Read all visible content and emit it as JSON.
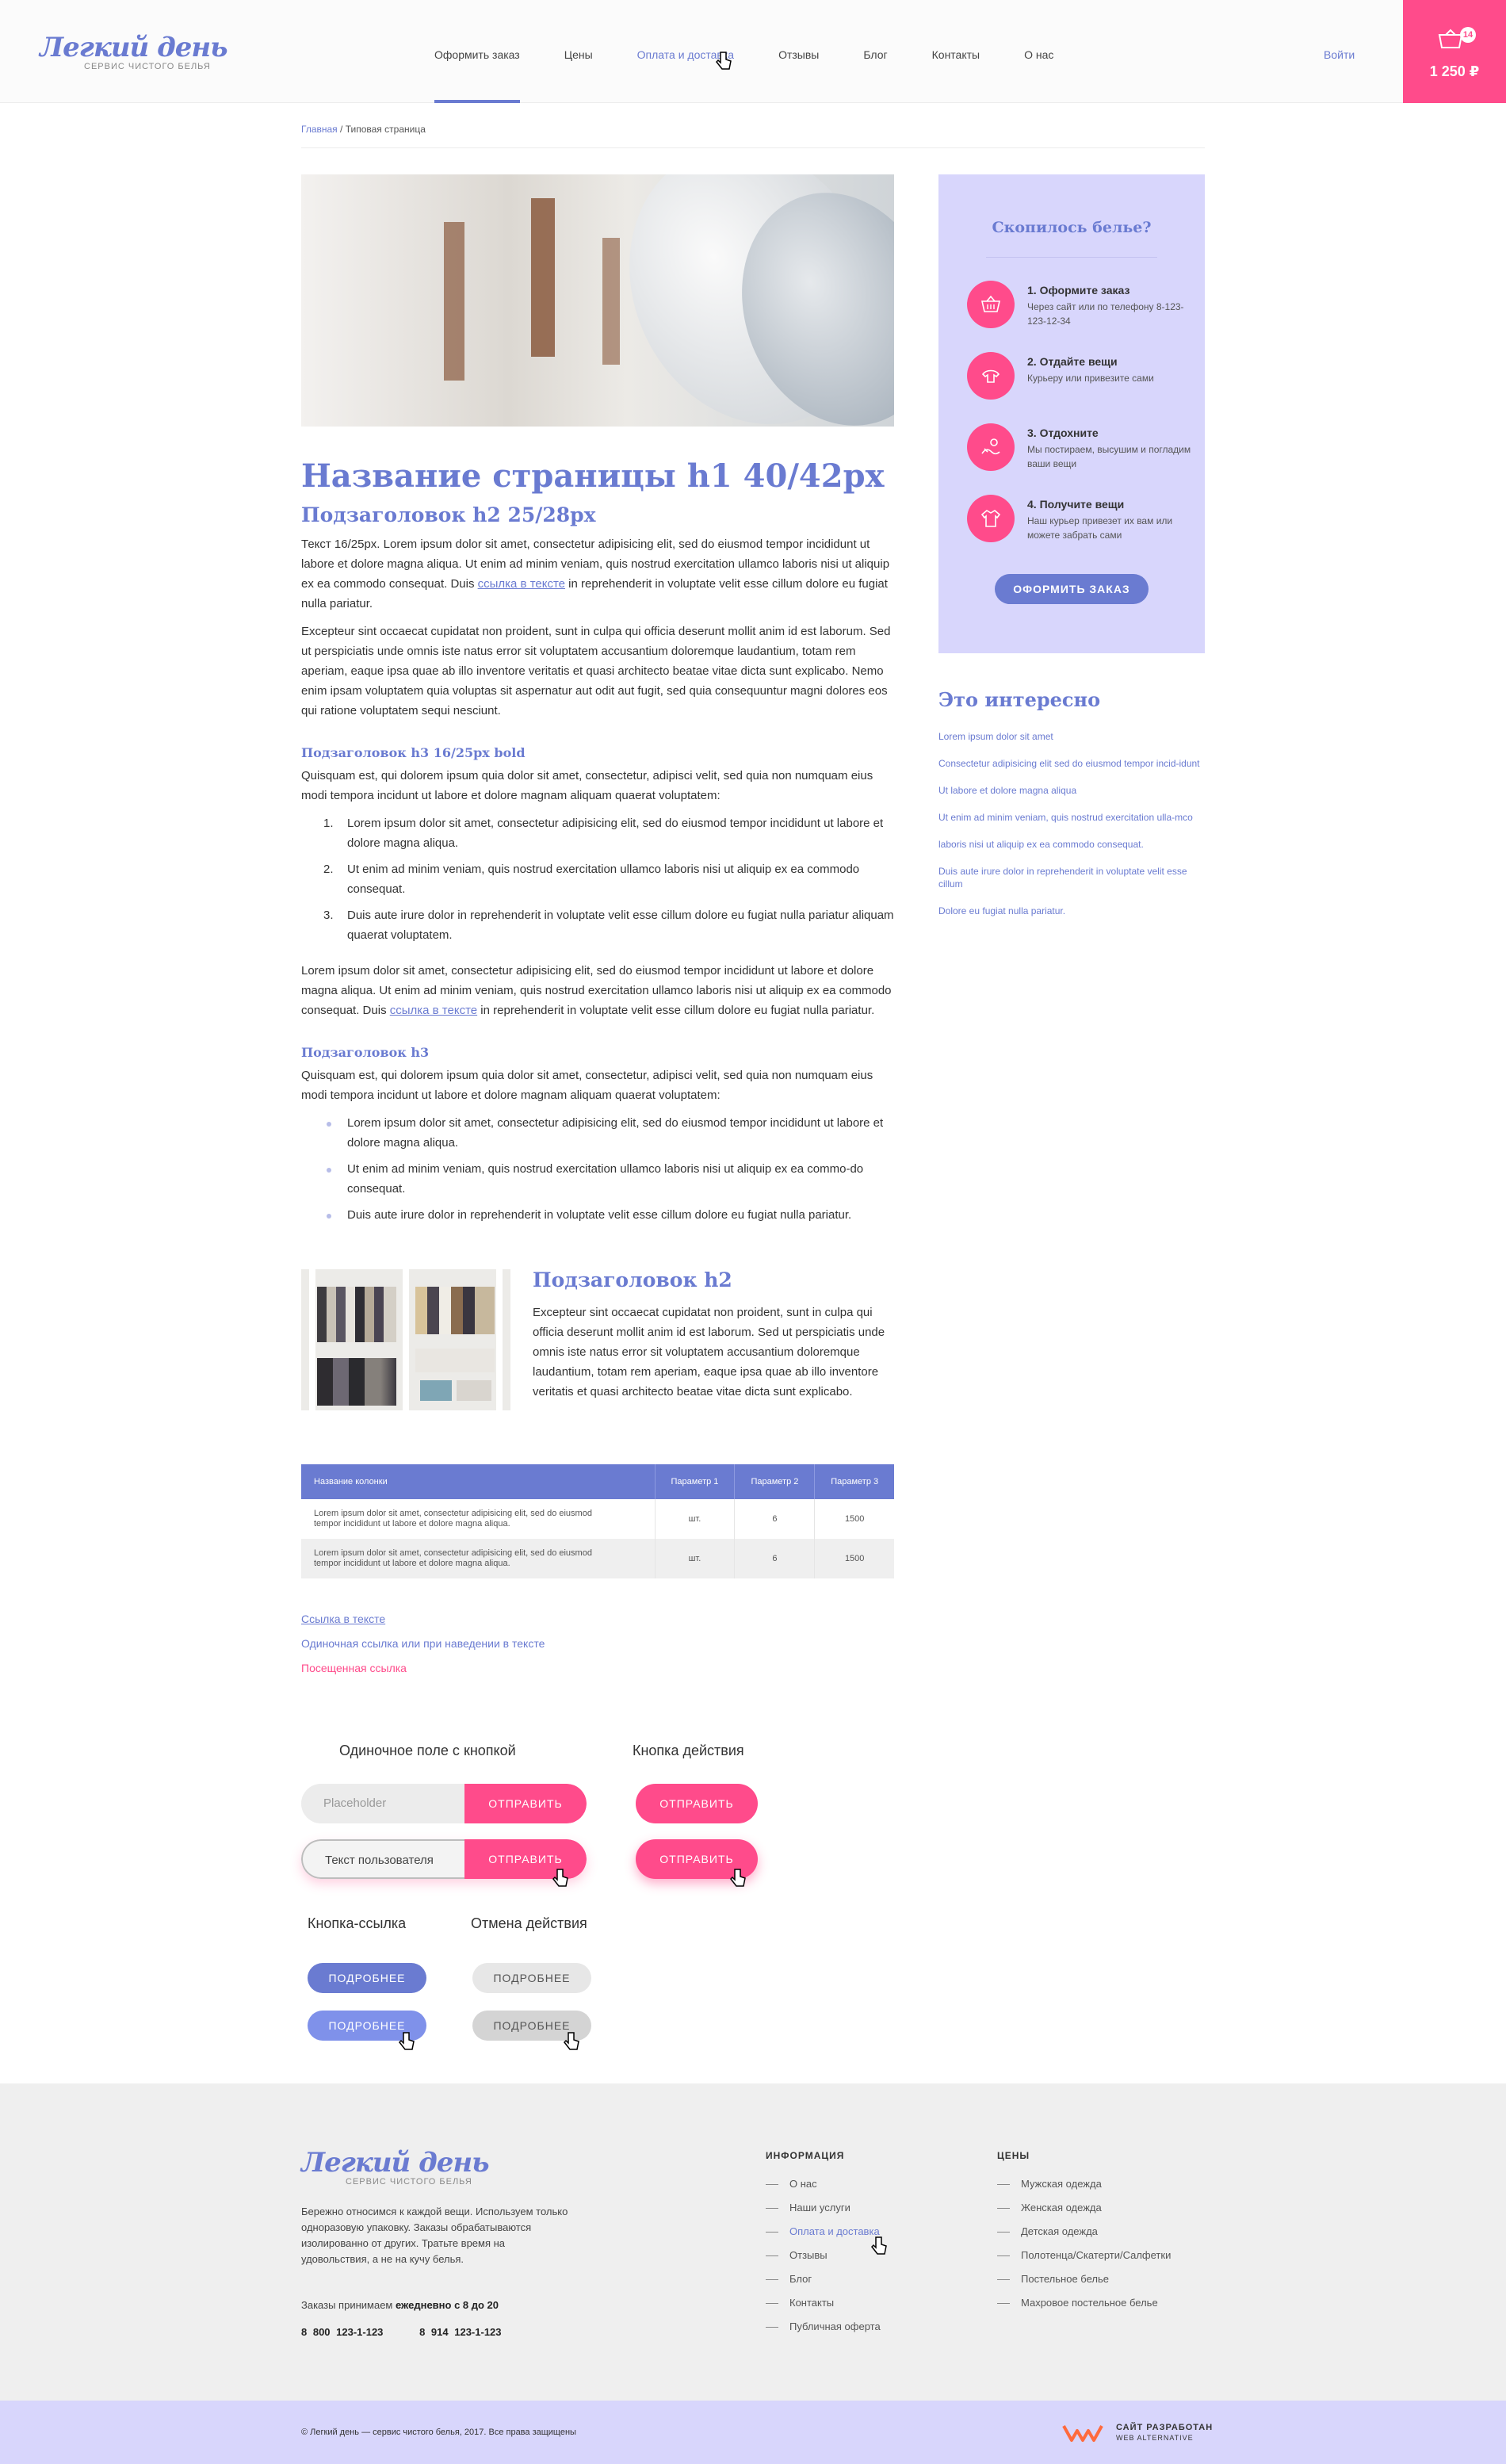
{
  "header": {
    "logo_main": "Легкий день",
    "logo_sub": "СЕРВИС ЧИСТОГО БЕЛЬЯ",
    "nav": [
      "Оформить заказ",
      "Цены",
      "Оплата и доставка",
      "Отзывы",
      "Блог",
      "Контакты",
      "О нас"
    ],
    "login": "Войти",
    "cart_count": "14",
    "cart_sum": "1 250 ₽"
  },
  "breadcrumb": {
    "home": "Главная",
    "sep": "/",
    "current": "Типовая страница"
  },
  "content": {
    "h1": "Название страницы h1 40/42px",
    "h2": "Подзаголовок h2 25/28px",
    "p1_before": "Текст 16/25px. Lorem ipsum dolor sit amet, consectetur adipisicing elit, sed do eiusmod tempor incididunt ut labore et dolore magna aliqua. Ut enim ad minim veniam, quis nostrud exercitation ullamco laboris nisi ut aliquip ex ea commodo consequat. Duis ",
    "p1_link": "ссылка в тексте",
    "p1_after": " in reprehenderit in voluptate velit esse cillum dolore eu fugiat nulla pariatur.",
    "p2": "Excepteur sint occaecat cupidatat non proident, sunt in culpa qui officia deserunt mollit anim id est laborum. Sed ut perspiciatis unde omnis iste natus error sit voluptatem accusantium doloremque laudantium, totam rem aperiam, eaque ipsa quae ab illo inventore veritatis et quasi architecto beatae vitae dicta sunt explicabo. Nemo enim ipsam voluptatem quia voluptas sit aspernatur aut odit aut fugit, sed quia consequuntur magni dolores eos qui ratione voluptatem sequi nesciunt.",
    "h3a": "Подзаголовок h3 16/25px bold",
    "p3": "Quisquam est, qui dolorem ipsum quia dolor sit amet, consectetur, adipisci velit, sed quia non numquam eius modi tempora incidunt ut labore et dolore magnam aliquam quaerat voluptatem:",
    "ol": [
      {
        "n": "1.",
        "t": "Lorem ipsum dolor sit amet, consectetur adipisicing elit, sed do eiusmod tempor incididunt ut labore et dolore magna aliqua."
      },
      {
        "n": "2.",
        "t": "Ut enim ad minim veniam, quis nostrud exercitation ullamco laboris nisi ut aliquip ex ea commodo consequat."
      },
      {
        "n": "3.",
        "t": "Duis aute irure dolor in reprehenderit in voluptate velit esse cillum dolore eu fugiat nulla pariatur aliquam quaerat voluptatem."
      }
    ],
    "p4_before": "Lorem ipsum dolor sit amet, consectetur adipisicing elit, sed do eiusmod tempor incididunt ut labore et dolore magna aliqua. Ut enim ad minim veniam, quis nostrud exercitation ullamco laboris nisi ut aliquip ex ea commodo consequat. Duis ",
    "p4_link": "ссылка в тексте",
    "p4_after": " in reprehenderit in voluptate velit esse cillum dolore eu fugiat nulla pariatur.",
    "h3b": "Подзаголовок h3",
    "p5": "Quisquam est, qui dolorem ipsum quia dolor sit amet, consectetur, adipisci velit, sed quia non numquam eius modi tempora incidunt ut labore et dolore magnam aliquam quaerat voluptatem:",
    "ul": [
      "Lorem ipsum dolor sit amet, consectetur adipisicing elit, sed do eiusmod tempor incididunt ut labore et dolore magna aliqua.",
      "Ut enim ad minim veniam, quis nostrud exercitation ullamco laboris nisi ut aliquip ex ea commo-do consequat.",
      "Duis aute irure dolor in reprehenderit in voluptate velit esse cillum dolore eu fugiat nulla pariatur."
    ],
    "media_h2": "Подзаголовок h2",
    "media_p": "Excepteur sint occaecat cupidatat non proident, sunt in culpa qui officia deserunt mollit anim id est laborum. Sed ut perspiciatis unde omnis iste natus error sit voluptatem accusantium doloremque laudantium, totam rem aperiam, eaque ipsa quae ab illo inventore veritatis et quasi architecto beatae vitae dicta sunt explicabo."
  },
  "table": {
    "headers": [
      "Название колонки",
      "Параметр 1",
      "Параметр 2",
      "Параметр 3"
    ],
    "rows": [
      [
        "Lorem ipsum dolor sit amet, consectetur adipisicing elit, sed do eiusmod tempor incididunt ut labore et dolore magna aliqua.",
        "шт.",
        "6",
        "1500"
      ],
      [
        "Lorem ipsum dolor sit amet, consectetur adipisicing elit, sed do eiusmod tempor incididunt ut labore et dolore magna aliqua.",
        "шт.",
        "6",
        "1500"
      ]
    ]
  },
  "links": {
    "l1": "Ссылка в тексте",
    "l2": "Одиночная ссылка или при наведении в тексте",
    "l3": "Посещенная ссылка"
  },
  "forms": {
    "field_title": "Одиночное поле с кнопкой",
    "action_title": "Кнопка действия",
    "placeholder": "Placeholder",
    "user_text": "Текст пользователя",
    "send": "ОТПРАВИТЬ",
    "link_btn_title": "Кнопка-ссылка",
    "cancel_title": "Отмена действия",
    "more": "ПОДРОБНЕЕ"
  },
  "sidebar": {
    "howto_title": "Скопилось белье?",
    "steps": [
      {
        "title": "1. Оформите заказ",
        "desc": "Через сайт или по телефону 8-123-123-12-34",
        "icon": "basket-icon"
      },
      {
        "title": "2. Отдайте вещи",
        "desc": "Курьеру или привезите сами",
        "icon": "clothes-icon"
      },
      {
        "title": "3. Отдохните",
        "desc": "Мы постираем, высушим и погладим ваши вещи",
        "icon": "relax-icon"
      },
      {
        "title": "4. Получите вещи",
        "desc": "Наш курьер привезет их вам или можете забрать сами",
        "icon": "shirt-icon"
      }
    ],
    "order_btn": "ОФОРМИТЬ ЗАКАЗ",
    "interest_title": "Это интересно",
    "interest_links": [
      "Lorem ipsum dolor sit amet",
      "Consectetur adipisicing elit sed do eiusmod tempor incid-idunt",
      "Ut labore et dolore magna aliqua",
      "Ut enim ad minim veniam, quis nostrud exercitation ulla-mco",
      "laboris nisi ut aliquip ex ea commodo consequat.",
      "Duis aute irure dolor in reprehenderit in voluptate velit esse cillum",
      "Dolore eu fugiat nulla pariatur."
    ]
  },
  "footer": {
    "desc": "Бережно относимся к каждой вещи. Используем только одноразовую упаковку. Заказы обрабатываются изолированно от других. Тратьте время на удовольствия, а не на кучу белья.",
    "hours_prefix": "Заказы принимаем",
    "hours_bold": "ежедневно с 8 до 20",
    "phone1": "8 800 123-1-123",
    "phone2": "8 914 123-1-123",
    "info_title": "ИНФОРМАЦИЯ",
    "info": [
      "О нас",
      "Наши услуги",
      "Оплата и доставка",
      "Отзывы",
      "Блог",
      "Контакты",
      "Публичная оферта"
    ],
    "prices_title": "ЦЕНЫ",
    "prices": [
      "Мужская одежда",
      "Женская одежда",
      "Детская одежда",
      "Полотенца/Скатерти/Салфетки",
      "Постельное белье",
      "Махровое постельное белье"
    ],
    "copyright": "© Легкий день — сервис чистого белья, 2017. Все права защищены",
    "dev_line1": "САЙТ РАЗРАБОТАН",
    "dev_line2": "WEB ALTERNATIVE"
  },
  "colors": {
    "accent": "#6a7bd1",
    "pink": "#ff4b8b",
    "lavender": "#d8d6fc"
  }
}
